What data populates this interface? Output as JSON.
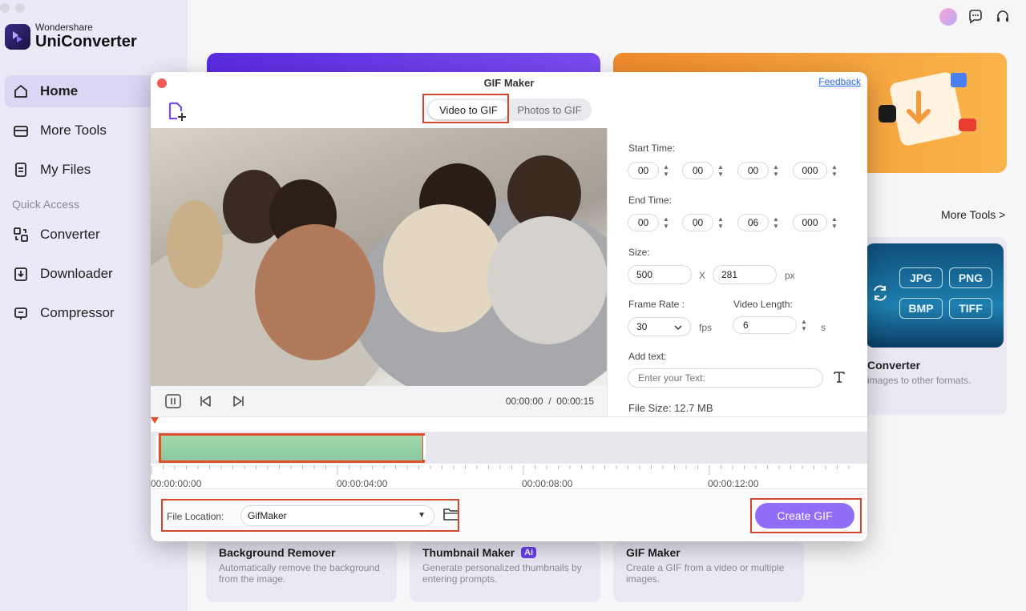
{
  "app": {
    "brand_sub": "Wondershare",
    "brand_main": "UniConverter"
  },
  "sidebar": {
    "items": [
      {
        "label": "Home",
        "icon": "home-icon"
      },
      {
        "label": "More Tools",
        "icon": "toolbox-icon"
      },
      {
        "label": "My Files",
        "icon": "file-icon"
      }
    ],
    "quick_access_title": "Quick Access",
    "quick_items": [
      {
        "label": "Converter",
        "icon": "converter-icon"
      },
      {
        "label": "Downloader",
        "icon": "downloader-icon"
      },
      {
        "label": "Compressor",
        "icon": "compressor-icon"
      }
    ]
  },
  "main": {
    "more_tools_link": "More Tools >",
    "image_converter": {
      "title": "Converter",
      "desc": "images to other formats.",
      "formats": [
        "JPG",
        "PNG",
        "BMP",
        "TIFF"
      ]
    },
    "cards": [
      {
        "title": "Background Remover",
        "desc": "Automatically remove the background from the image.",
        "badge": ""
      },
      {
        "title": "Thumbnail Maker",
        "desc": "Generate personalized thumbnails by entering prompts.",
        "badge": "Ai"
      },
      {
        "title": "GIF Maker",
        "desc": "Create a GIF from a video or multiple images.",
        "badge": ""
      }
    ]
  },
  "dialog": {
    "title": "GIF Maker",
    "feedback": "Feedback",
    "tabs": [
      "Video to GIF",
      "Photos to GIF"
    ],
    "active_tab": "Video to GIF",
    "player": {
      "current_time": "00:00:00",
      "separator": "/",
      "total_time": "00:00:15"
    },
    "settings": {
      "start_label": "Start Time:",
      "start": [
        "00",
        "00",
        "00",
        "000"
      ],
      "end_label": "End Time:",
      "end": [
        "00",
        "00",
        "06",
        "000"
      ],
      "size_label": "Size:",
      "width": "500",
      "x": "X",
      "height": "281",
      "size_unit": "px",
      "frame_rate_label": "Frame Rate :",
      "frame_rate": "30",
      "frame_rate_unit": "fps",
      "video_length_label": "Video Length:",
      "video_length": "6",
      "video_length_unit": "s",
      "add_text_label": "Add text:",
      "text_placeholder": "Enter your Text:",
      "file_size": "File Size:  12.7 MB"
    },
    "timeline": {
      "ticks": [
        "00:00:00:00",
        "00:00:04:00",
        "00:00:08:00",
        "00:00:12:00"
      ]
    },
    "footer": {
      "file_location_label": "File Location:",
      "file_location": "GifMaker",
      "create_button": "Create GIF"
    }
  },
  "colors": {
    "accent": "#8f6df6",
    "highlight": "#d4452b",
    "feedback_link": "#2b6be0"
  }
}
